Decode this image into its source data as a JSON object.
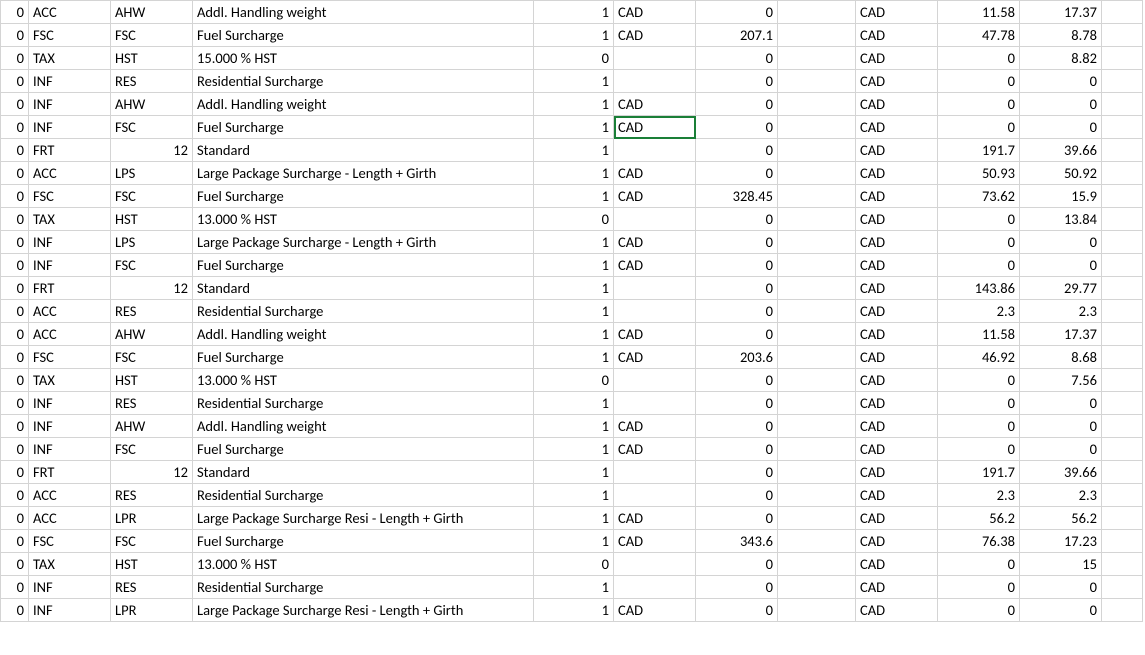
{
  "selected": {
    "row": 5,
    "col": 5
  },
  "rows": [
    {
      "c0": "0",
      "c1": "ACC",
      "c2": "AHW",
      "c3": "Addl. Handling weight",
      "c4": "1",
      "c5": "CAD",
      "c6": "0",
      "c7": "",
      "c8": "CAD",
      "c9": "11.58",
      "c10": "17.37",
      "c11": ""
    },
    {
      "c0": "0",
      "c1": "FSC",
      "c2": "FSC",
      "c3": "Fuel Surcharge",
      "c4": "1",
      "c5": "CAD",
      "c6": "207.1",
      "c7": "",
      "c8": "CAD",
      "c9": "47.78",
      "c10": "8.78",
      "c11": ""
    },
    {
      "c0": "0",
      "c1": "TAX",
      "c2": "HST",
      "c3": "15.000 %  HST",
      "c4": "0",
      "c5": "",
      "c6": "0",
      "c7": "",
      "c8": "CAD",
      "c9": "0",
      "c10": "8.82",
      "c11": ""
    },
    {
      "c0": "0",
      "c1": "INF",
      "c2": "RES",
      "c3": "Residential Surcharge",
      "c4": "1",
      "c5": "",
      "c6": "0",
      "c7": "",
      "c8": "CAD",
      "c9": "0",
      "c10": "0",
      "c11": ""
    },
    {
      "c0": "0",
      "c1": "INF",
      "c2": "AHW",
      "c3": "Addl. Handling weight",
      "c4": "1",
      "c5": "CAD",
      "c6": "0",
      "c7": "",
      "c8": "CAD",
      "c9": "0",
      "c10": "0",
      "c11": ""
    },
    {
      "c0": "0",
      "c1": "INF",
      "c2": "FSC",
      "c3": "Fuel Surcharge",
      "c4": "1",
      "c5": "CAD",
      "c6": "0",
      "c7": "",
      "c8": "CAD",
      "c9": "0",
      "c10": "0",
      "c11": ""
    },
    {
      "c0": "0",
      "c1": "FRT",
      "c2": "12",
      "c3": "Standard",
      "c4": "1",
      "c5": "",
      "c6": "0",
      "c7": "",
      "c8": "CAD",
      "c9": "191.7",
      "c10": "39.66",
      "c11": ""
    },
    {
      "c0": "0",
      "c1": "ACC",
      "c2": "LPS",
      "c3": "Large Package Surcharge - Length + Girth",
      "c4": "1",
      "c5": "CAD",
      "c6": "0",
      "c7": "",
      "c8": "CAD",
      "c9": "50.93",
      "c10": "50.92",
      "c11": ""
    },
    {
      "c0": "0",
      "c1": "FSC",
      "c2": "FSC",
      "c3": "Fuel Surcharge",
      "c4": "1",
      "c5": "CAD",
      "c6": "328.45",
      "c7": "",
      "c8": "CAD",
      "c9": "73.62",
      "c10": "15.9",
      "c11": ""
    },
    {
      "c0": "0",
      "c1": "TAX",
      "c2": "HST",
      "c3": "13.000 %  HST",
      "c4": "0",
      "c5": "",
      "c6": "0",
      "c7": "",
      "c8": "CAD",
      "c9": "0",
      "c10": "13.84",
      "c11": ""
    },
    {
      "c0": "0",
      "c1": "INF",
      "c2": "LPS",
      "c3": "Large Package Surcharge - Length + Girth",
      "c4": "1",
      "c5": "CAD",
      "c6": "0",
      "c7": "",
      "c8": "CAD",
      "c9": "0",
      "c10": "0",
      "c11": ""
    },
    {
      "c0": "0",
      "c1": "INF",
      "c2": "FSC",
      "c3": "Fuel Surcharge",
      "c4": "1",
      "c5": "CAD",
      "c6": "0",
      "c7": "",
      "c8": "CAD",
      "c9": "0",
      "c10": "0",
      "c11": ""
    },
    {
      "c0": "0",
      "c1": "FRT",
      "c2": "12",
      "c3": "Standard",
      "c4": "1",
      "c5": "",
      "c6": "0",
      "c7": "",
      "c8": "CAD",
      "c9": "143.86",
      "c10": "29.77",
      "c11": ""
    },
    {
      "c0": "0",
      "c1": "ACC",
      "c2": "RES",
      "c3": "Residential Surcharge",
      "c4": "1",
      "c5": "",
      "c6": "0",
      "c7": "",
      "c8": "CAD",
      "c9": "2.3",
      "c10": "2.3",
      "c11": ""
    },
    {
      "c0": "0",
      "c1": "ACC",
      "c2": "AHW",
      "c3": "Addl. Handling weight",
      "c4": "1",
      "c5": "CAD",
      "c6": "0",
      "c7": "",
      "c8": "CAD",
      "c9": "11.58",
      "c10": "17.37",
      "c11": ""
    },
    {
      "c0": "0",
      "c1": "FSC",
      "c2": "FSC",
      "c3": "Fuel Surcharge",
      "c4": "1",
      "c5": "CAD",
      "c6": "203.6",
      "c7": "",
      "c8": "CAD",
      "c9": "46.92",
      "c10": "8.68",
      "c11": ""
    },
    {
      "c0": "0",
      "c1": "TAX",
      "c2": "HST",
      "c3": "13.000 %  HST",
      "c4": "0",
      "c5": "",
      "c6": "0",
      "c7": "",
      "c8": "CAD",
      "c9": "0",
      "c10": "7.56",
      "c11": ""
    },
    {
      "c0": "0",
      "c1": "INF",
      "c2": "RES",
      "c3": "Residential Surcharge",
      "c4": "1",
      "c5": "",
      "c6": "0",
      "c7": "",
      "c8": "CAD",
      "c9": "0",
      "c10": "0",
      "c11": ""
    },
    {
      "c0": "0",
      "c1": "INF",
      "c2": "AHW",
      "c3": "Addl. Handling weight",
      "c4": "1",
      "c5": "CAD",
      "c6": "0",
      "c7": "",
      "c8": "CAD",
      "c9": "0",
      "c10": "0",
      "c11": ""
    },
    {
      "c0": "0",
      "c1": "INF",
      "c2": "FSC",
      "c3": "Fuel Surcharge",
      "c4": "1",
      "c5": "CAD",
      "c6": "0",
      "c7": "",
      "c8": "CAD",
      "c9": "0",
      "c10": "0",
      "c11": ""
    },
    {
      "c0": "0",
      "c1": "FRT",
      "c2": "12",
      "c3": "Standard",
      "c4": "1",
      "c5": "",
      "c6": "0",
      "c7": "",
      "c8": "CAD",
      "c9": "191.7",
      "c10": "39.66",
      "c11": ""
    },
    {
      "c0": "0",
      "c1": "ACC",
      "c2": "RES",
      "c3": "Residential Surcharge",
      "c4": "1",
      "c5": "",
      "c6": "0",
      "c7": "",
      "c8": "CAD",
      "c9": "2.3",
      "c10": "2.3",
      "c11": ""
    },
    {
      "c0": "0",
      "c1": "ACC",
      "c2": "LPR",
      "c3": "Large Package Surcharge Resi  - Length + Girth",
      "c4": "1",
      "c5": "CAD",
      "c6": "0",
      "c7": "",
      "c8": "CAD",
      "c9": "56.2",
      "c10": "56.2",
      "c11": ""
    },
    {
      "c0": "0",
      "c1": "FSC",
      "c2": "FSC",
      "c3": "Fuel Surcharge",
      "c4": "1",
      "c5": "CAD",
      "c6": "343.6",
      "c7": "",
      "c8": "CAD",
      "c9": "76.38",
      "c10": "17.23",
      "c11": ""
    },
    {
      "c0": "0",
      "c1": "TAX",
      "c2": "HST",
      "c3": "13.000 %  HST",
      "c4": "0",
      "c5": "",
      "c6": "0",
      "c7": "",
      "c8": "CAD",
      "c9": "0",
      "c10": "15",
      "c11": ""
    },
    {
      "c0": "0",
      "c1": "INF",
      "c2": "RES",
      "c3": "Residential Surcharge",
      "c4": "1",
      "c5": "",
      "c6": "0",
      "c7": "",
      "c8": "CAD",
      "c9": "0",
      "c10": "0",
      "c11": ""
    },
    {
      "c0": "0",
      "c1": "INF",
      "c2": "LPR",
      "c3": "Large Package Surcharge Resi  - Length + Girth",
      "c4": "1",
      "c5": "CAD",
      "c6": "0",
      "c7": "",
      "c8": "CAD",
      "c9": "0",
      "c10": "0",
      "c11": ""
    }
  ],
  "col_align": {
    "c0": "r",
    "c1": "l",
    "c2": "l",
    "c3": "l",
    "c4": "r",
    "c5": "l",
    "c6": "r",
    "c7": "l",
    "c8": "l",
    "c9": "r",
    "c10": "r",
    "c11": "l"
  },
  "numeric_c2_rows": [
    6,
    12,
    20
  ]
}
